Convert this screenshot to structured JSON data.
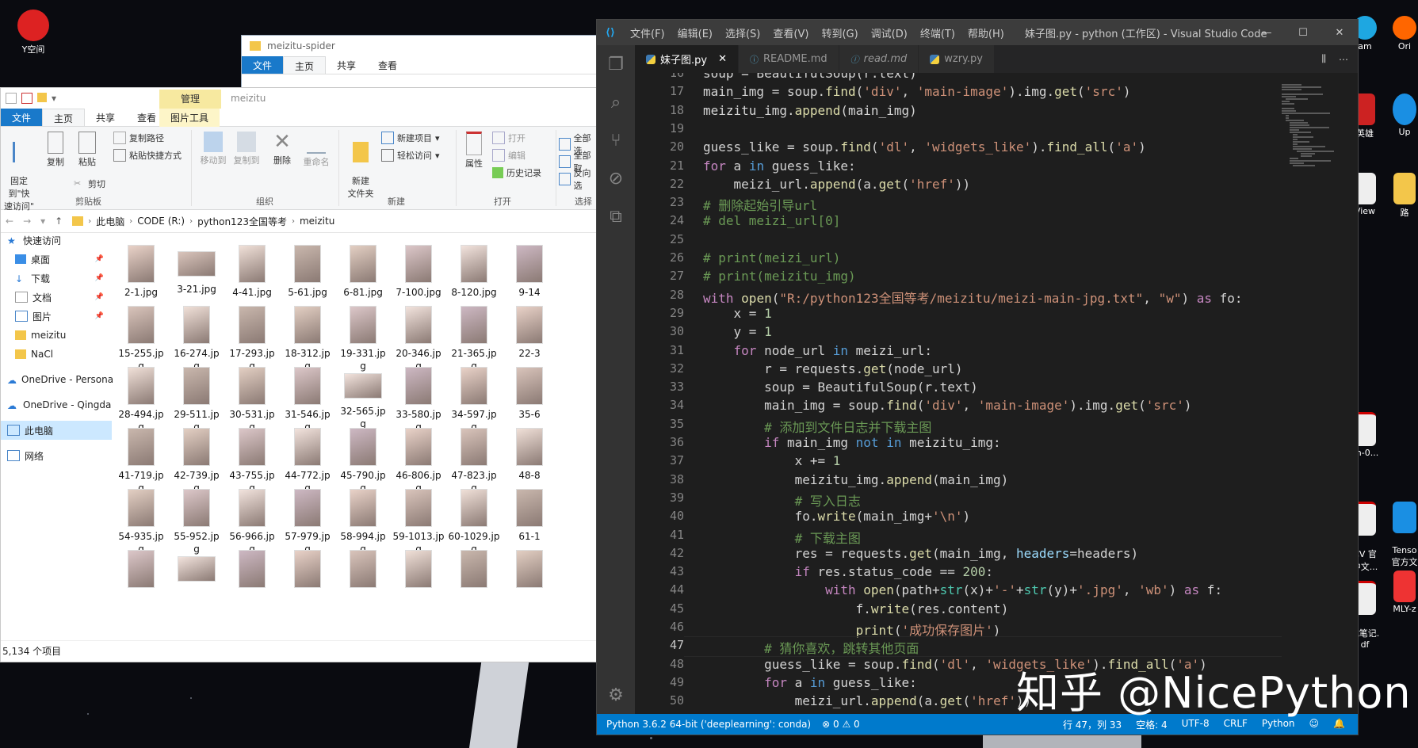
{
  "desktop": {
    "left_icons": [
      {
        "label": "Y空间"
      }
    ],
    "right_icons": [
      {
        "label": "am"
      },
      {
        "label": "Ori"
      },
      {
        "label": "英雄"
      },
      {
        "label": "Up"
      },
      {
        "label": "View"
      },
      {
        "label": "路"
      },
      {
        "label": "ch-0..."
      },
      {
        "label": "CV 官\n中文..."
      },
      {
        "label": "Tenso\n官方文"
      },
      {
        "label": "式笔记.\ndf"
      },
      {
        "label": "MLY-z"
      }
    ]
  },
  "explorer_back": {
    "title": "meizitu-spider",
    "tabs": [
      "文件",
      "主页",
      "共享",
      "查看"
    ]
  },
  "explorer": {
    "title": "meizitu",
    "context_tab_group": "管理",
    "tabs": [
      "文件",
      "主页",
      "共享",
      "查看"
    ],
    "context_tab": "图片工具",
    "ribbon": {
      "pin_quick": "固定到\"快\n速访问\"",
      "copy": "复制",
      "paste": "粘贴",
      "copy_path": "复制路径",
      "paste_shortcut": "粘贴快捷方式",
      "cut": "剪切",
      "move_to": "移动到",
      "copy_to": "复制到",
      "delete": "删除",
      "rename": "重命名",
      "new_folder": "新建\n文件夹",
      "new_item": "新建项目",
      "easy_access": "轻松访问",
      "properties": "属性",
      "open": "打开",
      "edit": "编辑",
      "history": "历史记录",
      "select_all": "全部选",
      "select_none": "全部取",
      "invert": "反向选",
      "groups": [
        "剪贴板",
        "组织",
        "新建",
        "打开",
        "选择"
      ]
    },
    "breadcrumb": [
      "此电脑",
      "CODE (R:)",
      "python123全国等考",
      "meizitu"
    ],
    "nav": [
      {
        "label": "快速访问",
        "pinned": false
      },
      {
        "label": "桌面",
        "pinned": true
      },
      {
        "label": "下载",
        "pinned": true
      },
      {
        "label": "文档",
        "pinned": true
      },
      {
        "label": "图片",
        "pinned": true
      },
      {
        "label": "meizitu",
        "pinned": false
      },
      {
        "label": "NaCl",
        "pinned": false
      },
      {
        "label": "OneDrive - Persona",
        "pinned": false
      },
      {
        "label": "OneDrive - Qingda",
        "pinned": false
      },
      {
        "label": "此电脑",
        "pinned": false
      },
      {
        "label": "网络",
        "pinned": false
      }
    ],
    "files": [
      [
        "2-1.jpg",
        "3-21.jpg",
        "4-41.jpg",
        "5-61.jpg",
        "6-81.jpg",
        "7-100.jpg",
        "8-120.jpg",
        "9-14"
      ],
      [
        "15-255.jp\ng",
        "16-274.jp\ng",
        "17-293.jp\ng",
        "18-312.jp\ng",
        "19-331.jp\ng",
        "20-346.jp\ng",
        "21-365.jp\ng",
        "22-3"
      ],
      [
        "28-494.jp\ng",
        "29-511.jp\ng",
        "30-531.jp\ng",
        "31-546.jp\ng",
        "32-565.jp\ng",
        "33-580.jp\ng",
        "34-597.jp\ng",
        "35-6"
      ],
      [
        "41-719.jp\ng",
        "42-739.jp\ng",
        "43-755.jp\ng",
        "44-772.jp\ng",
        "45-790.jp\ng",
        "46-806.jp\ng",
        "47-823.jp\ng",
        "48-8"
      ],
      [
        "54-935.jp\ng",
        "55-952.jp\ng",
        "56-966.jp\ng",
        "57-979.jp\ng",
        "58-994.jp\ng",
        "59-1013.jp\ng",
        "60-1029.jp\ng",
        "61-1"
      ],
      [
        "",
        "",
        "",
        "",
        "",
        "",
        "",
        ""
      ]
    ],
    "status": "5,134 个项目"
  },
  "vscode": {
    "menu": [
      "文件(F)",
      "编辑(E)",
      "选择(S)",
      "查看(V)",
      "转到(G)",
      "调试(D)",
      "终端(T)",
      "帮助(H)"
    ],
    "title": "妹子图.py - python (工作区) - Visual Studio Code",
    "tabs": [
      {
        "label": "妹子图.py",
        "active": true
      },
      {
        "label": "README.md",
        "active": false
      },
      {
        "label": "read.md",
        "active": false
      },
      {
        "label": "wzry.py",
        "active": false
      }
    ],
    "lines": [
      {
        "n": "16",
        "html": "soup = BeautifulSoup(r.text)"
      },
      {
        "n": "17",
        "html": "main_img = soup.<span class='f'>find</span>(<span class='s'>'div'</span>, <span class='s'>'main-image'</span>).img.<span class='f'>get</span>(<span class='s'>'src'</span>)"
      },
      {
        "n": "18",
        "html": "meizitu_img.<span class='f'>append</span>(main_img)"
      },
      {
        "n": "19",
        "html": ""
      },
      {
        "n": "20",
        "html": "guess_like = soup.<span class='f'>find</span>(<span class='s'>'dl'</span>, <span class='s'>'widgets_like'</span>).<span class='f'>find_all</span>(<span class='s'>'a'</span>)"
      },
      {
        "n": "21",
        "html": "<span class='k'>for</span> a <span class='kb'>in</span> guess_like:"
      },
      {
        "n": "22",
        "html": "    meizi_url.<span class='f'>append</span>(a.<span class='f'>get</span>(<span class='s'>'href'</span>))"
      },
      {
        "n": "23",
        "html": "<span class='c'># 删除起始引导url</span>"
      },
      {
        "n": "24",
        "html": "<span class='c'># del meizi_url[0]</span>"
      },
      {
        "n": "25",
        "html": ""
      },
      {
        "n": "26",
        "html": "<span class='c'># print(meizi_url)</span>"
      },
      {
        "n": "27",
        "html": "<span class='c'># print(meizitu_img)</span>"
      },
      {
        "n": "28",
        "html": "<span class='k'>with</span> <span class='f'>open</span>(<span class='s'>\"R:/python123全国等考/meizitu/meizi-main-jpg.txt\"</span>, <span class='s'>\"w\"</span>) <span class='k'>as</span> fo:"
      },
      {
        "n": "29",
        "html": "    x = <span class='n'>1</span>"
      },
      {
        "n": "30",
        "html": "    y = <span class='n'>1</span>"
      },
      {
        "n": "31",
        "html": "    <span class='k'>for</span> node_url <span class='kb'>in</span> meizi_url:"
      },
      {
        "n": "32",
        "html": "        r = requests.<span class='f'>get</span>(node_url)"
      },
      {
        "n": "33",
        "html": "        soup = BeautifulSoup(r.text)"
      },
      {
        "n": "34",
        "html": "        main_img = soup.<span class='f'>find</span>(<span class='s'>'div'</span>, <span class='s'>'main-image'</span>).img.<span class='f'>get</span>(<span class='s'>'src'</span>)"
      },
      {
        "n": "35",
        "html": "        <span class='c'># 添加到文件日志并下载主图</span>"
      },
      {
        "n": "36",
        "html": "        <span class='k'>if</span> main_img <span class='kb'>not in</span> meizitu_img:"
      },
      {
        "n": "37",
        "html": "            x += <span class='n'>1</span>"
      },
      {
        "n": "38",
        "html": "            meizitu_img.<span class='f'>append</span>(main_img)"
      },
      {
        "n": "39",
        "html": "            <span class='c'># 写入日志</span>"
      },
      {
        "n": "40",
        "html": "            fo.<span class='f'>write</span>(main_img+<span class='s'>'\\n'</span>)"
      },
      {
        "n": "41",
        "html": "            <span class='c'># 下载主图</span>"
      },
      {
        "n": "42",
        "html": "            res = requests.<span class='f'>get</span>(main_img, <span class='v'>headers</span>=headers)"
      },
      {
        "n": "43",
        "html": "            <span class='k'>if</span> res.status_code == <span class='n'>200</span>:"
      },
      {
        "n": "44",
        "html": "                <span class='k'>with</span> <span class='f'>open</span>(path+<span class='t'>str</span>(x)+<span class='s'>'-'</span>+<span class='t'>str</span>(y)+<span class='s'>'.jpg'</span>, <span class='s'>'wb'</span>) <span class='k'>as</span> f:"
      },
      {
        "n": "45",
        "html": "                    f.<span class='f'>write</span>(res.content)"
      },
      {
        "n": "46",
        "html": "                    <span class='f'>print</span>(<span class='s'>'成功保存图片'</span>)"
      },
      {
        "n": "47",
        "html": "        <span class='c'># 猜你喜欢，跳转其他页面</span>"
      },
      {
        "n": "48",
        "html": "        guess_like = soup.<span class='f'>find</span>(<span class='s'>'dl'</span>, <span class='s'>'widgets_like'</span>).<span class='f'>find_all</span>(<span class='s'>'a'</span>)"
      },
      {
        "n": "49",
        "html": "        <span class='k'>for</span> a <span class='kb'>in</span> guess_like:"
      },
      {
        "n": "50",
        "html": "            meizi_url.<span class='f'>append</span>(a.<span class='f'>get</span>(<span class='s'>'href'</span>))"
      }
    ],
    "current_line": "47",
    "status": {
      "interpreter": "Python 3.6.2 64-bit ('deeplearning': conda)",
      "problems": "⊗ 0 ⚠ 0",
      "position": "行 47，列 33",
      "spaces": "空格: 4",
      "encoding": "UTF-8",
      "eol": "CRLF",
      "language": "Python"
    }
  },
  "watermark": "知乎 @NicePython",
  "colors": {
    "accent": "#007acc",
    "ribbon_file": "#1979ca",
    "picture_tools": "#f7e9a0"
  }
}
